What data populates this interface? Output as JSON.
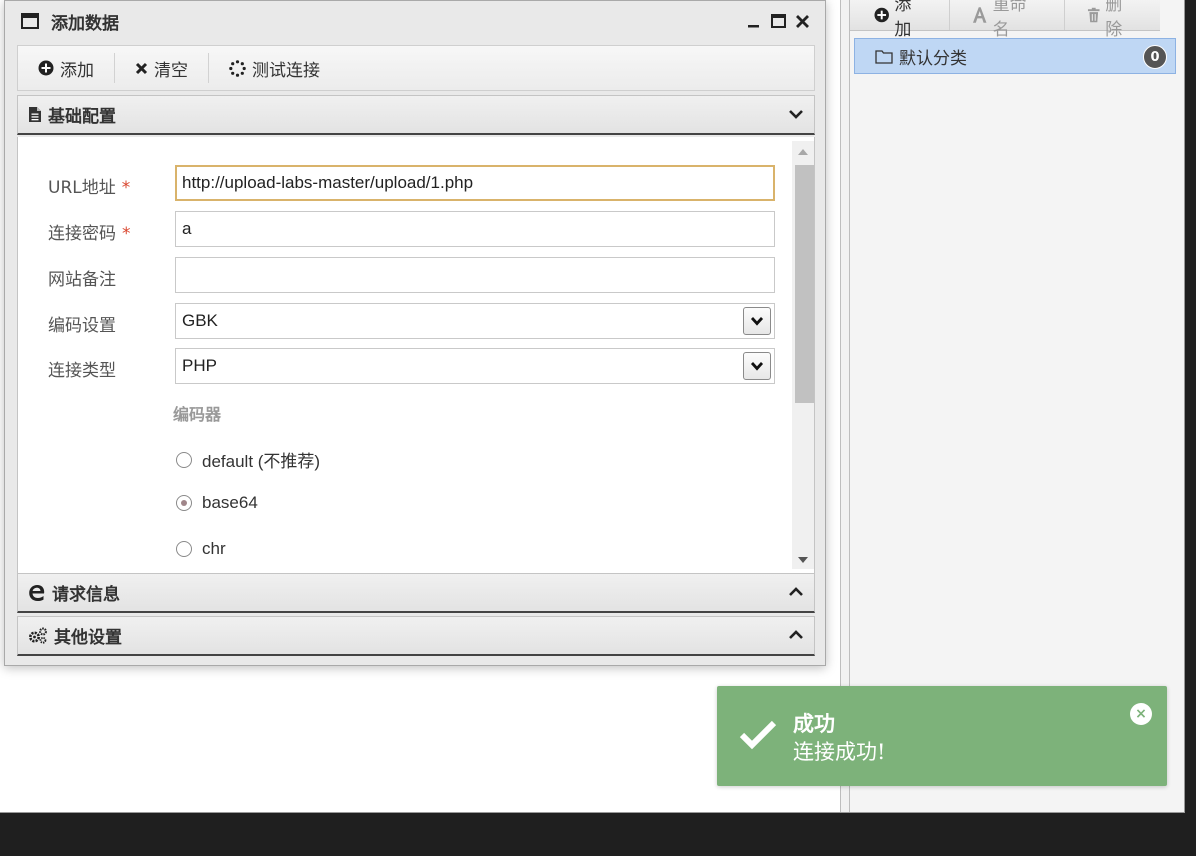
{
  "dialog": {
    "title": "添加数据",
    "controls": {
      "minimize": "_",
      "maximize": "□",
      "close": "✕"
    }
  },
  "toolbar": {
    "add_label": "添加",
    "clear_label": "清空",
    "test_label": "测试连接"
  },
  "sections": {
    "basic": "基础配置",
    "request": "请求信息",
    "other": "其他设置"
  },
  "form": {
    "url_label": "URL地址",
    "url_value": "http://upload-labs-master/upload/1.php",
    "password_label": "连接密码",
    "password_value": "a",
    "note_label": "网站备注",
    "note_value": "",
    "encoding_label": "编码设置",
    "encoding_value": "GBK",
    "type_label": "连接类型",
    "type_value": "PHP",
    "required_mark": "*",
    "encoder_title": "编码器",
    "encoders": [
      {
        "label": "default (不推荐)",
        "checked": false
      },
      {
        "label": "base64",
        "checked": true
      },
      {
        "label": "chr",
        "checked": false
      }
    ]
  },
  "right_panel": {
    "toolbar": {
      "add": "添加",
      "rename": "重命名",
      "delete": "删除"
    },
    "category": {
      "name": "默认分类",
      "count": "0"
    }
  },
  "toast": {
    "title": "成功",
    "message": "连接成功!",
    "close": "×",
    "color": "#7db27a"
  }
}
